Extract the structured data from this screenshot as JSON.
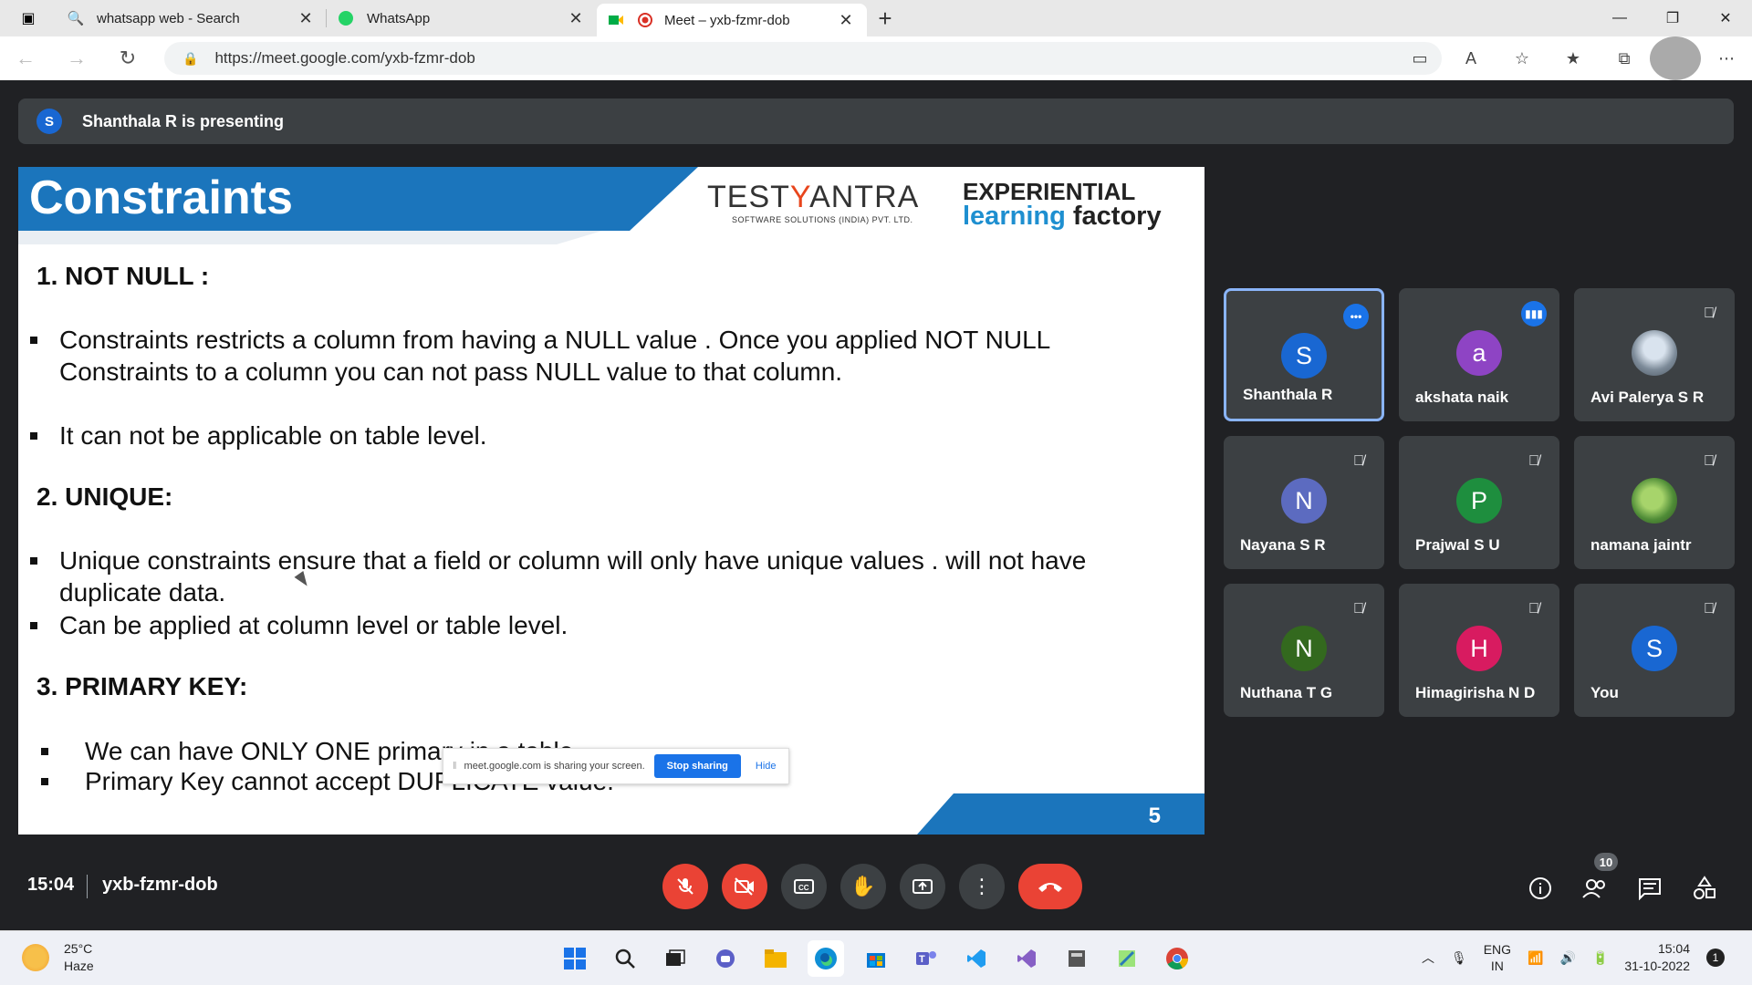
{
  "browser": {
    "tabs": [
      {
        "title": "whatsapp web - Search",
        "icon": "search-icon"
      },
      {
        "title": "WhatsApp",
        "icon": "whatsapp-icon"
      },
      {
        "title": "Meet – yxb-fzmr-dob",
        "icon": "meet-icon",
        "active": true
      }
    ],
    "url": "https://meet.google.com/yxb-fzmr-dob"
  },
  "presenting": {
    "avatar_letter": "S",
    "text": "Shanthala R is presenting"
  },
  "slide": {
    "title": "Constraints",
    "logo_main_a": "TEST",
    "logo_main_b": "Y",
    "logo_main_c": "ANTRA",
    "logo_sub": "SOFTWARE SOLUTIONS (INDIA) PVT. LTD.",
    "tagline_1": "EXPERIENTIAL",
    "tagline_2a": "learning",
    "tagline_2b": "factory",
    "sections": [
      {
        "heading": "1. NOT NULL :"
      },
      {
        "heading": "2. UNIQUE:"
      },
      {
        "heading": "3. PRIMARY KEY:"
      }
    ],
    "bullets": [
      "Constraints restricts  a column from having a NULL value . Once you applied NOT NULL",
      "Constraints to a column you can not pass NULL value to that column.",
      "It can not be applicable on table level.",
      "Unique constraints ensure that a field or column will only have unique values . will not have",
      "duplicate data.",
      "Can be applied at column level or table level.",
      "We can have ONLY ONE primary in a table",
      "Primary Key cannot accept DUPLICATE value."
    ],
    "page_number": "5"
  },
  "share_notice": {
    "text": "meet.google.com is sharing your screen.",
    "stop": "Stop sharing",
    "hide": "Hide"
  },
  "participants": [
    {
      "name": "Shanthala R",
      "letter": "S",
      "color": "#1967d2",
      "status": "more"
    },
    {
      "name": "akshata naik",
      "letter": "a",
      "color": "#8e44c4",
      "status": "speaking"
    },
    {
      "name": "Avi Palerya S R",
      "letter": "",
      "color": "#7d8b99",
      "status": "muted"
    },
    {
      "name": "Nayana S R",
      "letter": "N",
      "color": "#5c6bc0",
      "status": "muted"
    },
    {
      "name": "Prajwal S U",
      "letter": "P",
      "color": "#1e8e3e",
      "status": "muted"
    },
    {
      "name": "namana jaintr",
      "letter": "",
      "color": "#4f8c37",
      "status": "muted"
    },
    {
      "name": "Nuthana T G",
      "letter": "N",
      "color": "#33691e",
      "status": "muted"
    },
    {
      "name": "Himagirisha N D",
      "letter": "H",
      "color": "#d81b60",
      "status": "muted"
    },
    {
      "name": "You",
      "letter": "S",
      "color": "#1967d2",
      "status": "muted"
    }
  ],
  "meeting": {
    "time": "15:04",
    "code": "yxb-fzmr-dob",
    "people_count": "10"
  },
  "taskbar": {
    "temp": "25°C",
    "weather": "Haze",
    "lang_1": "ENG",
    "lang_2": "IN",
    "time": "15:04",
    "date": "31-10-2022",
    "notifications": "1"
  }
}
